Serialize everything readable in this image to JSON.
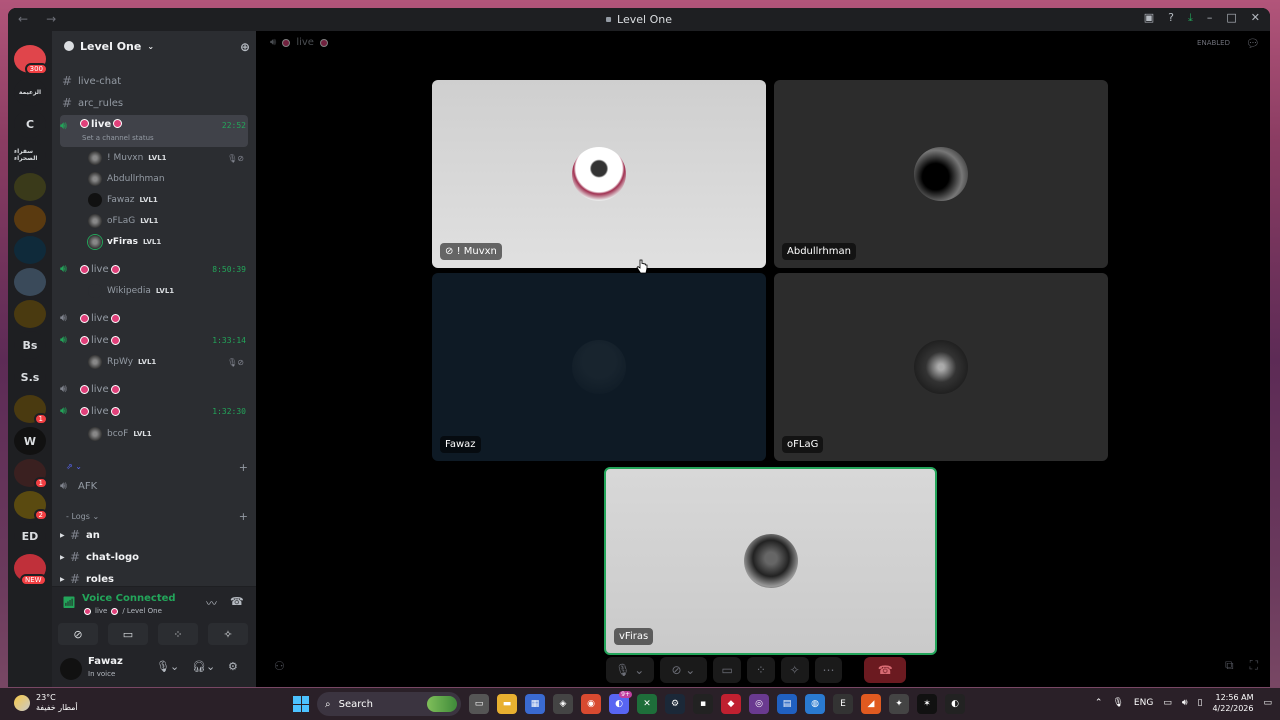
{
  "window": {
    "title": "Level One",
    "enabled_label": "ENABLED"
  },
  "guilds": [
    {
      "label": "",
      "badge": "300",
      "color": "#e0454b"
    },
    {
      "label": "الزعيمة",
      "badge": "",
      "color": "#1e1f22"
    },
    {
      "label": "C",
      "badge": "",
      "color": "#1e1f22"
    },
    {
      "label": "سفراء الصحراء",
      "badge": "",
      "color": "#1e1f22"
    },
    {
      "label": "",
      "badge": "",
      "color": "#3a3a1a"
    },
    {
      "label": "",
      "badge": "",
      "color": "#5a3a10"
    },
    {
      "label": "",
      "badge": "",
      "color": "#0f2a3a"
    },
    {
      "label": "",
      "badge": "",
      "color": "#3a4a5a"
    },
    {
      "label": "",
      "badge": "",
      "color": "#4a3a10"
    },
    {
      "label": "Bs",
      "badge": "",
      "color": "#1e1f22"
    },
    {
      "label": "S.s",
      "badge": "",
      "color": "#1e1f22"
    },
    {
      "label": "",
      "badge": "1",
      "color": "#4a3a10"
    },
    {
      "label": "W",
      "badge": "",
      "color": "#111111"
    },
    {
      "label": "",
      "badge": "1",
      "color": "#3a2020"
    },
    {
      "label": "",
      "badge": "2",
      "color": "#5a4a10"
    },
    {
      "label": "ED",
      "badge": "",
      "color": "#1e1f22"
    },
    {
      "label": "",
      "badge_top": "NEW",
      "color": "#c0303a"
    }
  ],
  "server": {
    "name": "Level One",
    "text_channels": [
      "live-chat",
      "arc_rules"
    ],
    "voice_channels": [
      {
        "name": "live",
        "time": "22:52",
        "status": "Set a channel status",
        "members": [
          {
            "name": "! Muvxn",
            "tag": "LVL1"
          },
          {
            "name": "Abdullrhman",
            "tag": ""
          },
          {
            "name": "Fawaz",
            "tag": "LVL1"
          },
          {
            "name": "oFLaG",
            "tag": "LVL1"
          },
          {
            "name": "vFiras",
            "tag": "LVL1"
          }
        ]
      },
      {
        "name": "live",
        "time": "8:50:39",
        "members": [
          {
            "name": "Wikipedia",
            "tag": "LVL1"
          }
        ]
      },
      {
        "name": "live",
        "time": "",
        "members": []
      },
      {
        "name": "live",
        "time": "1:33:14",
        "members": [
          {
            "name": "RpWy",
            "tag": "LVL1"
          }
        ]
      },
      {
        "name": "live",
        "time": "",
        "members": []
      },
      {
        "name": "live",
        "time": "1:32:30",
        "members": [
          {
            "name": "bcoF",
            "tag": "LVL1"
          }
        ]
      }
    ],
    "afk_channel": "AFK",
    "logs_category": "Logs",
    "log_channels": [
      "an",
      "chat-logo",
      "roles"
    ]
  },
  "voice_panel": {
    "title": "Voice Connected",
    "channel": "live",
    "server": "/ Level One"
  },
  "user_panel": {
    "name": "Fawaz",
    "status": "In voice"
  },
  "stage": {
    "channel": "live",
    "tiles": [
      {
        "name": "! Muvxn"
      },
      {
        "name": "Abdullrhman"
      },
      {
        "name": "Fawaz"
      },
      {
        "name": "oFLaG"
      },
      {
        "name": "vFiras"
      }
    ]
  },
  "taskbar": {
    "temperature": "23°C",
    "weather": "أمطار خفيفة",
    "search_placeholder": "Search",
    "lang": "ENG",
    "time": "12:56 AM",
    "date": "4/22/2026",
    "discord_badge": "9+"
  }
}
